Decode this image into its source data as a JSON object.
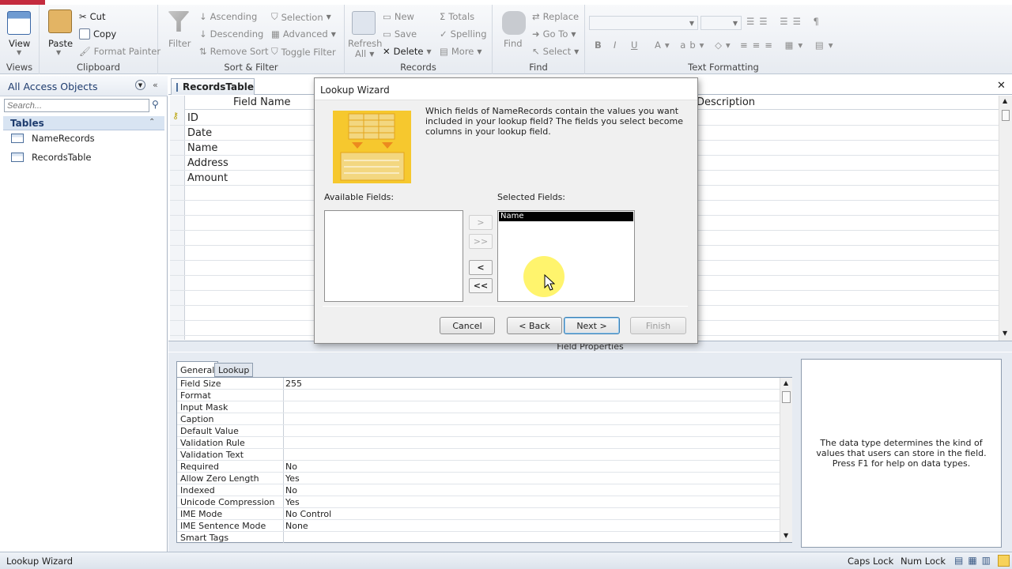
{
  "ribbon": {
    "views": {
      "view": "View",
      "label": "Views"
    },
    "clipboard": {
      "paste": "Paste",
      "cut": "Cut",
      "copy": "Copy",
      "format_painter": "Format Painter",
      "label": "Clipboard"
    },
    "sort_filter": {
      "filter": "Filter",
      "ascending": "Ascending",
      "descending": "Descending",
      "remove_sort": "Remove Sort",
      "selection": "Selection",
      "advanced": "Advanced",
      "toggle_filter": "Toggle Filter",
      "label": "Sort & Filter"
    },
    "records": {
      "refresh": "Refresh",
      "refresh_all": "All",
      "new": "New",
      "save": "Save",
      "delete": "Delete",
      "totals": "Totals",
      "spelling": "Spelling",
      "more": "More",
      "label": "Records"
    },
    "find": {
      "find": "Find",
      "replace": "Replace",
      "goto": "Go To",
      "select": "Select",
      "label": "Find"
    },
    "text_formatting": {
      "bold": "B",
      "italic": "I",
      "underline": "U",
      "label": "Text Formatting"
    }
  },
  "nav": {
    "header": "All Access Objects",
    "search_placeholder": "Search...",
    "group": "Tables",
    "items": [
      "NameRecords",
      "RecordsTable"
    ]
  },
  "document": {
    "tab": "RecordsTable",
    "col_field_name": "Field Name",
    "col_description": "Description",
    "fields": [
      "ID",
      "Date",
      "Name",
      "Address",
      "Amount"
    ]
  },
  "field_properties": {
    "title": "Field Properties",
    "tabs": [
      "General",
      "Lookup"
    ],
    "rows": [
      {
        "name": "Field Size",
        "value": "255"
      },
      {
        "name": "Format",
        "value": ""
      },
      {
        "name": "Input Mask",
        "value": ""
      },
      {
        "name": "Caption",
        "value": ""
      },
      {
        "name": "Default Value",
        "value": ""
      },
      {
        "name": "Validation Rule",
        "value": ""
      },
      {
        "name": "Validation Text",
        "value": ""
      },
      {
        "name": "Required",
        "value": "No"
      },
      {
        "name": "Allow Zero Length",
        "value": "Yes"
      },
      {
        "name": "Indexed",
        "value": "No"
      },
      {
        "name": "Unicode Compression",
        "value": "Yes"
      },
      {
        "name": "IME Mode",
        "value": "No Control"
      },
      {
        "name": "IME Sentence Mode",
        "value": "None"
      },
      {
        "name": "Smart Tags",
        "value": ""
      }
    ],
    "help": "The data type determines the kind of values that users can store in the field. Press F1 for help on data types."
  },
  "dialog": {
    "title": "Lookup Wizard",
    "instruction": "Which fields of NameRecords contain the values you want included in your lookup field? The fields you select become columns in your lookup field.",
    "available_label": "Available Fields:",
    "selected_label": "Selected Fields:",
    "selected_items": [
      "Name"
    ],
    "move_one": ">",
    "move_all": ">>",
    "remove_one": "<",
    "remove_all": "<<",
    "cancel": "Cancel",
    "back": "< Back",
    "next": "Next >",
    "finish": "Finish"
  },
  "status": {
    "left": "Lookup Wizard",
    "caps": "Caps Lock",
    "num": "Num Lock"
  },
  "colors": {
    "accent": "#c42b3e",
    "nav_group": "#d8e4f2",
    "wizard_art": "#f6c82e"
  }
}
